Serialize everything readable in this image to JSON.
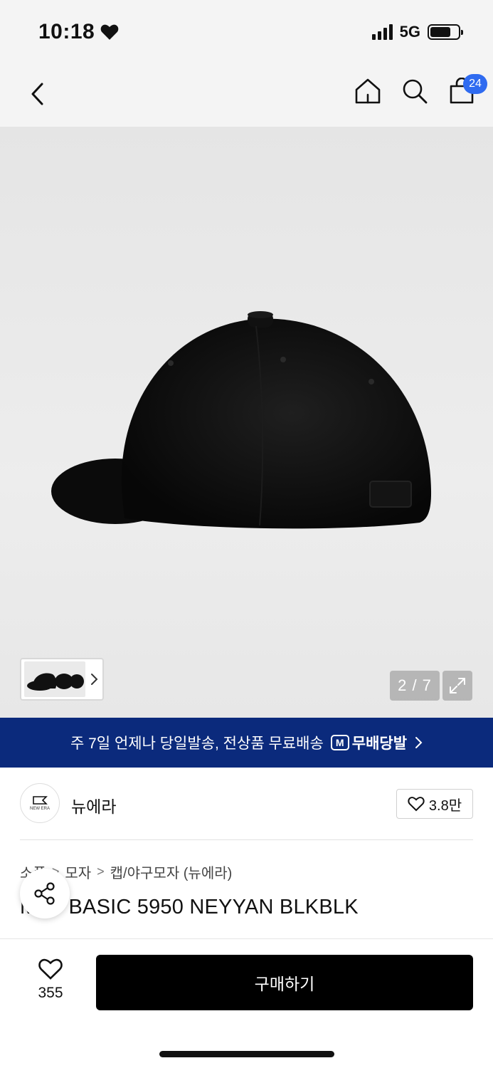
{
  "status_bar": {
    "time": "10:18",
    "network": "5G"
  },
  "nav": {
    "cart_count": "24"
  },
  "gallery": {
    "page_indicator": "2 / 7"
  },
  "banner": {
    "text": "주 7일 언제나 당일발송, 전상품 무료배송",
    "logo_mark": "M",
    "logo_text": "무배당발"
  },
  "brand": {
    "name": "뉴에라",
    "logo_text": "NEW ERA",
    "likes": "3.8만"
  },
  "breadcrumb": [
    "소품",
    "모자",
    "캡/야구모자 (뉴에라)"
  ],
  "product": {
    "title": "MLB BASIC 5950 NEYYAN BLKBLK"
  },
  "bottom_bar": {
    "wish_count": "355",
    "buy_label": "구매하기"
  },
  "colors": {
    "banner_bg": "#0b2a7c",
    "badge": "#2f6bf0",
    "buy_button": "#000000"
  }
}
